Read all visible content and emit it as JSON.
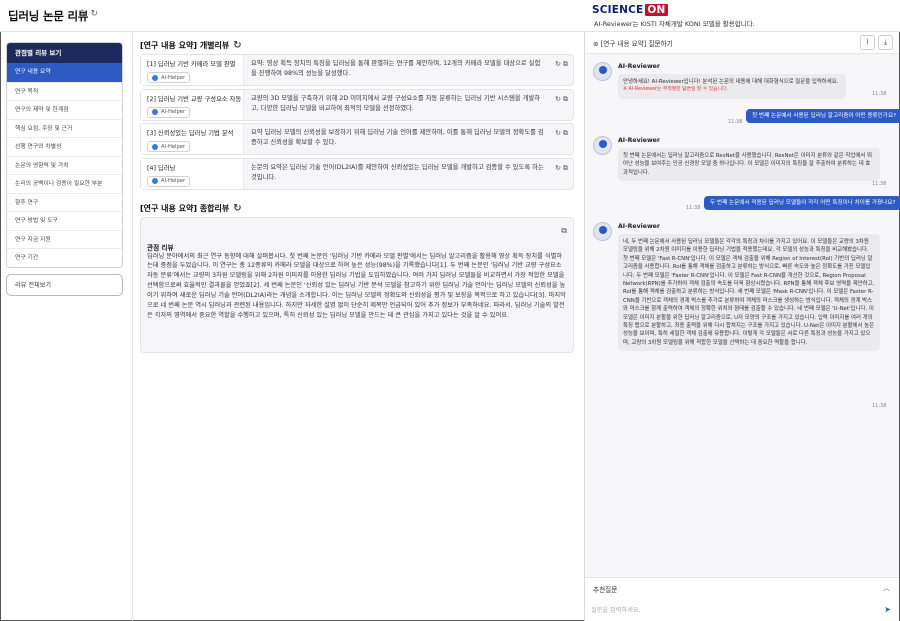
{
  "header": {
    "title": "딥러닝 논문 리뷰",
    "brand_science": "SCIENCE",
    "brand_on": "ON",
    "brand_sub": "AI-Reviewer는 KISTI 자체개발 KONI 모델을 활용합니다."
  },
  "sidebar": {
    "heading": "관점별 리뷰 보기",
    "items": [
      "연구 내용 요약",
      "연구 목적",
      "연구의 제약 및 한계점",
      "핵심 요점, 주장 및 근거",
      "선행 연구와 차별성",
      "논문의 영향력 및 가치",
      "논리의 공백이나 검증이 필요한 부분",
      "향후 연구",
      "연구 방법 및 도구",
      "연구 자금 지원",
      "연구 기간"
    ],
    "all_reviews": "리뷰 전체보기"
  },
  "individual": {
    "title": "[연구 내용 요약] 개별리뷰",
    "helper_label": "AI-Helper",
    "cards": [
      {
        "title": "[1] 딥러닝 기반 카메라 모델 판별",
        "text": "요약: 영상 획득 장치의 특징을 딥러닝을 통해 판별하는 연구를 제안하며, 12개의 카메라 모델을 대상으로 실험을 진행하여 98%의 성능을 달성했다."
      },
      {
        "title": "[2] 딥러닝 기반 교량 구성요소 자동 분류",
        "text": "교량의 3D 모델을 구축하기 위해 2D 이미지에서 교량 구성요소를 자동 분류하는 딥러닝 기반 시스템을 개발하고, 다양한 딥러닝 모델을 비교하여 최적의 모델을 선정하였다."
      },
      {
        "title": "[3] 신뢰성있는 딥러닝 기법 분석",
        "text": "요약 딥러닝 모델의 신뢰성을 보장하기 위해 딥러닝 기술 언어를 제안하며, 이를 통해 딥러닝 모델의 정확도를 검증하고 신뢰성을 확보할 수 있다."
      },
      {
        "title": "[4] 딥러닝",
        "text": "논문의 요약은 딥러닝 기술 언어(DL2IA)를 제안하여 신뢰성있는 딥러닝 모델을 개발하고 검증할 수 있도록 하는 것입니다."
      }
    ]
  },
  "combined": {
    "title": "[연구 내용 요약] 종합리뷰",
    "heading": "관점 리뷰",
    "text": "딥러닝 분야에서의 최근 연구 동향에 대해 살펴봅시다. 첫 번째 논문인 '딥러닝 기반 카메라 모델 판별'에서는 딥러닝 알고리즘을 활용해 영상 획득 장치를 식별하는데 중점을 두었습니다. 이 연구는 총 12종류의 카메라 모델을 대상으로 하여 높은 성능(98%)을 기록했습니다[1]. 두 번째 논문인 '딥러닝 기반 교량 구성요소 자동 분류'에서는 교량의 3차원 모델링을 위해 2차원 이미지를 이용한 딥러닝 기법을 도입하였습니다. 여러 가지 딥러닝 모델들을 비교하면서 가장 적합한 모델을 선택함으로써 효율적인 결과물을 얻었죠[2]. 세 번째 논문인 '신뢰성 있는 딥러닝 기반 분석 모델을 참고하기 위한 딥러닝 기술 언어'는 딥러닝 모델의 신뢰성을 높이기 위하여 새로운 딥러닝 기술 언어(DL2IA)라는 개념을 소개합니다. 이는 딥러닝 모델의 정확도와 신뢰성을 평가 및 보장을 목적으로 하고 있습니다[3]. 마지막으로 네 번째 논문 역시 딥러닝과 관련된 내용입니다. 하지만 자세한 설명 없이 단순히 제목만 언급되어 있어 추가 정보가 부족하네요. 따라서, 딥러닝 기술의 발전은 각자의 영역에서 중요한 역할을 수행하고 있으며, 특히 신뢰성 있는 딥러닝 모델을 만드는 데 큰 관심을 가지고 있다는 것을 알 수 있어요."
  },
  "chat": {
    "title": "[연구 내용 요약] 질문하기",
    "bot_name": "AI-Reviewer",
    "messages": [
      {
        "text": "안녕하세요! AI-Reviewer입니다! 분석된 논문의 내용에 대해 대화형식으로 질문을 입력하세요.",
        "note": "※ AI-Reviewer는 부적절한 답변일 할 수 있습니다.",
        "time": "11:38"
      },
      {
        "user": "첫 번째 논문에서 사용된 딥러닝 알고리즘이 어떤 종류인가요?",
        "time": "11:38"
      },
      {
        "text": "첫 번째 논문에서는 딥러닝 알고리즘으로 ResNet을 사용했습니다. ResNet은 이미지 분류와 같은 작업에서 뛰어난 성능을 보여주는 인공 신경망 모델 중 하나입니다. 이 모델은 이미지의 특징을 잘 추출하여 분류하는 데 효과적입니다.",
        "time": "11:38"
      },
      {
        "user": "두 번째 논문에서 적용된 딥러닝 모델들이 각각 어떤 특징이나 차이를 가졌나요?",
        "time": "11:38"
      },
      {
        "text": "네, 두 번째 논문에서 사용된 딥러닝 모델들은 각각의 특징과 차이를 가지고 있어요. 이 모델들은 교량의 3차원 모델링을 위해 2차원 이미지를 이용한 딥러닝 기법을 적용했는데요, 각 모델의 성능과 특징을 비교해봤습니다. 첫 번째 모델은 'Fast R-CNN'입니다. 이 모델은 객체 검출을 위해 Region of Interest(RoI) 기반의 딥러닝 알고리즘을 사용합니다. RoI를 통해 객체를 검출하고 분류하는 방식으로, 빠른 속도와 높은 정확도를 가진 모델입니다. 두 번째 모델은 'Faster R-CNN'입니다. 이 모델은 Fast R-CNN을 개선한 것으로, Region Proposal Network(RPN)를 추가하여 객체 검출의 속도를 더욱 향상시켰습니다. RPN을 통해 객체 후보 영역을 제안하고, RoI를 통해 객체를 검출하고 분류하는 방식입니다. 세 번째 모델은 'Mask R-CNN'입니다. 이 모델은 Faster R-CNN을 기반으로 객체의 경계 박스를 추가로 분류하여 객체의 마스크를 생성하는 방식입니다. 객체의 경계 박스와 마스크를 함께 출력하여 객체의 정확한 위치와 형태를 검출할 수 있습니다. 네 번째 모델은 'U-Net'입니다. 이 모델은 이미지 분할을 위한 딥러닝 알고리즘으로, U자 모양의 구조를 가지고 있습니다. 입력 이미지를 여러 개의 특징 맵으로 분할하고, 최종 출력을 위해 다시 합쳐지는 구조를 가지고 있습니다. U-Net은 이미지 분할에서 높은 성능을 보이며, 특히 세밀한 객체 검출에 유용합니다. 이렇게 각 모델들은 서로 다른 특징과 성능을 가지고 있으며, 교량의 3차원 모델링을 위해 적합한 모델을 선택하는 데 중요한 역할을 합니다.",
        "time": "11:38"
      }
    ],
    "recommended": "추천질문",
    "input_placeholder": "질문을 입력하세요."
  }
}
